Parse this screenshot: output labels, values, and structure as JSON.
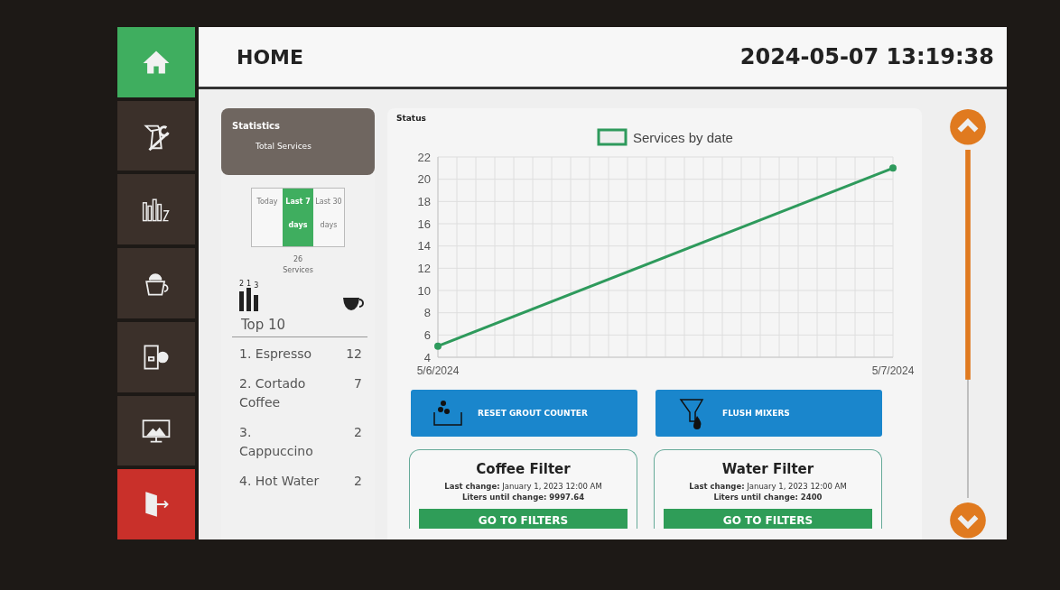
{
  "sidebar": {
    "items": [
      {
        "kind": "home",
        "selected": true
      },
      {
        "kind": "tools",
        "selected": false
      },
      {
        "kind": "stats",
        "selected": false
      },
      {
        "kind": "cup",
        "selected": false
      },
      {
        "kind": "machine",
        "selected": false
      },
      {
        "kind": "display",
        "selected": false
      },
      {
        "kind": "exit",
        "selected": false
      }
    ]
  },
  "header": {
    "title": "HOME",
    "datetime": "2024-05-07 13:19:38"
  },
  "statistics": {
    "title": "Statistics",
    "subtitle": "Total Services",
    "periods": [
      {
        "label": "Today",
        "selected": false
      },
      {
        "label": "Last 7 days",
        "selected": true
      },
      {
        "label": "Last 30 days",
        "selected": false
      }
    ],
    "count": "26",
    "count_label": "Services",
    "podium": [
      "2",
      "1",
      "3"
    ],
    "top_title": "Top 10",
    "top": [
      {
        "name": "1. Espresso",
        "count": "12"
      },
      {
        "name": "2. Cortado Coffee",
        "count": "7"
      },
      {
        "name": "3. Cappuccino",
        "count": "2"
      },
      {
        "name": "4. Hot Water",
        "count": "2"
      }
    ]
  },
  "status": {
    "title": "Status",
    "chart_data": {
      "type": "line",
      "categories": [
        "5/6/2024",
        "5/7/2024"
      ],
      "series": [
        {
          "name": "Services by date",
          "color": "#2e9a5c",
          "marker": "circle",
          "values": [
            5,
            21
          ]
        }
      ],
      "ylim": [
        4,
        22
      ],
      "yticks": [
        4,
        6,
        8,
        10,
        12,
        14,
        16,
        18,
        20,
        22
      ]
    },
    "actions": [
      {
        "kind": "grout",
        "label": "RESET GROUT COUNTER"
      },
      {
        "kind": "flush",
        "label": "FLUSH MIXERS"
      }
    ],
    "filters": [
      {
        "title": "Coffee Filter",
        "last_change_label": "Last change:",
        "last_change": "January 1, 2023 12:00 AM",
        "liters_label": "Liters until change:",
        "liters": "9997.64",
        "button": "GO TO FILTERS"
      },
      {
        "title": "Water Filter",
        "last_change_label": "Last change:",
        "last_change": "January 1, 2023 12:00 AM",
        "liters_label": "Liters until change:",
        "liters": "2400",
        "button": "GO TO FILTERS"
      }
    ]
  }
}
